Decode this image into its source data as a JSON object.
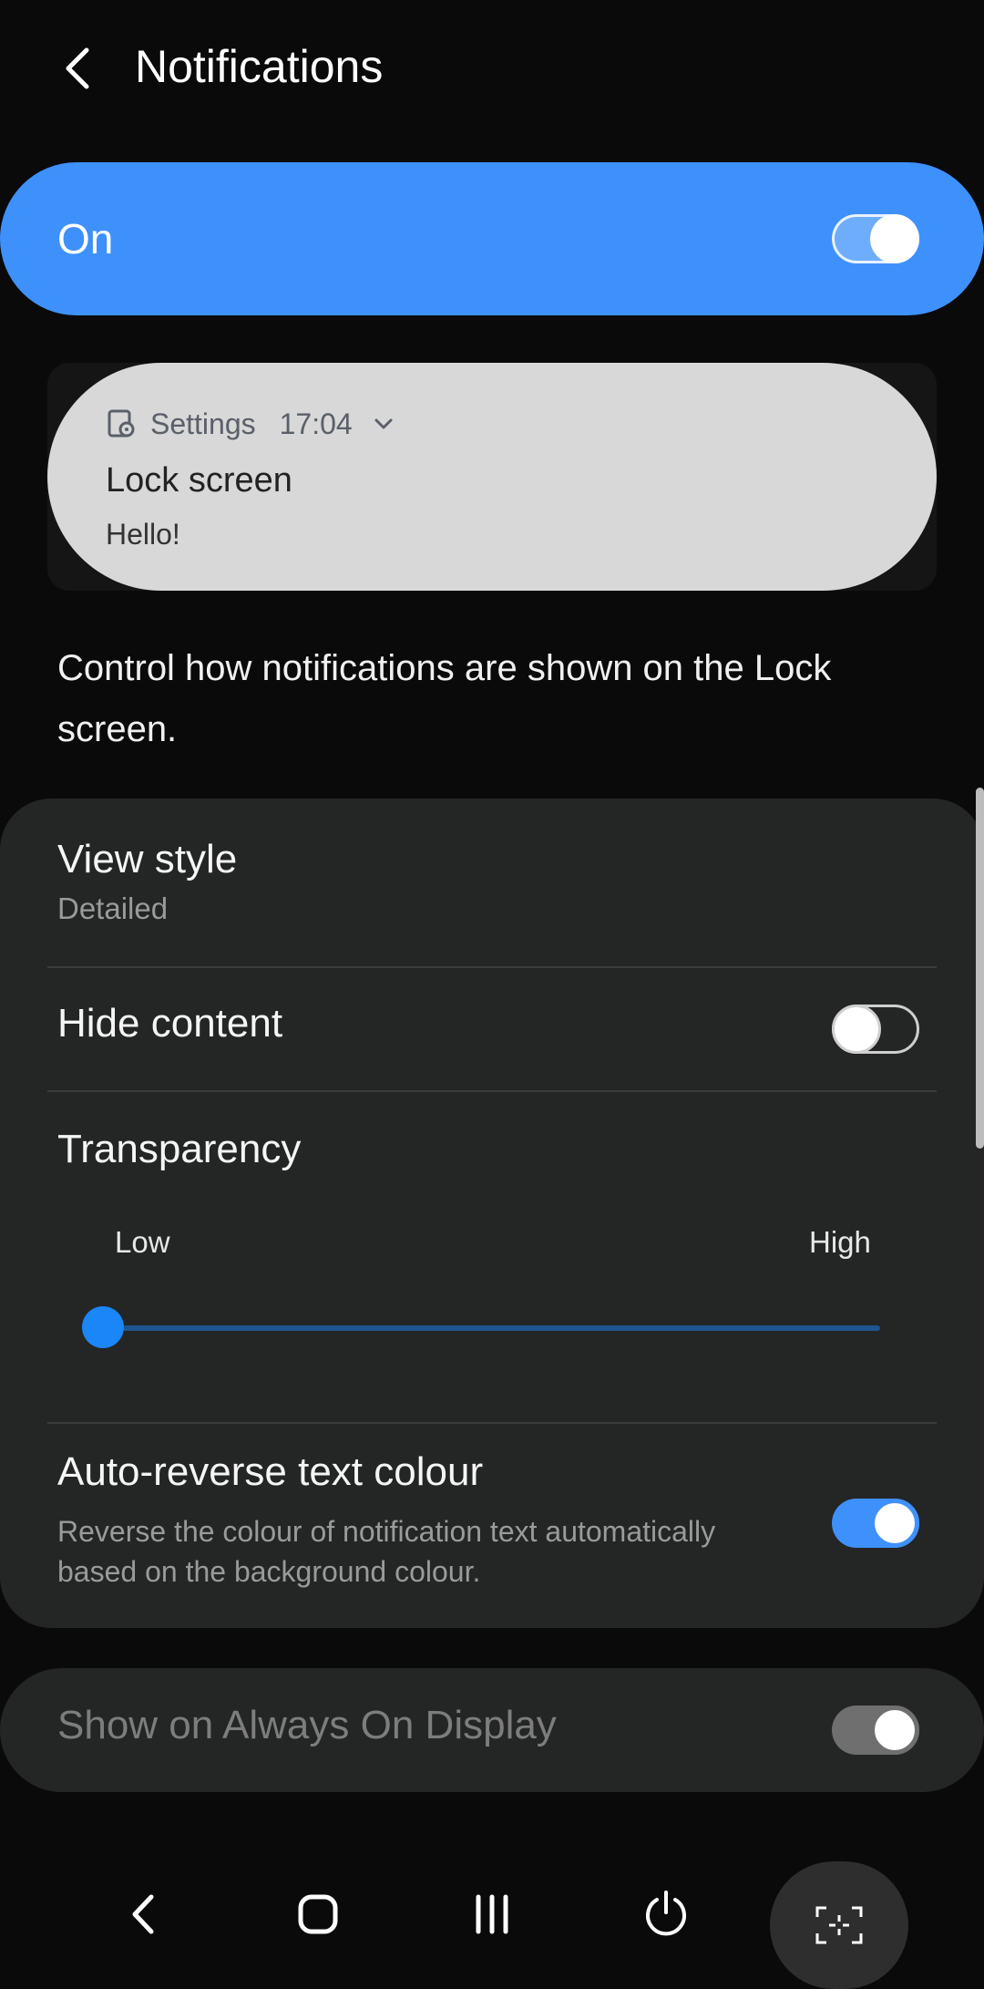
{
  "header": {
    "title": "Notifications"
  },
  "master": {
    "label": "On",
    "enabled": true,
    "accent_color": "#3e91fb"
  },
  "preview": {
    "app_icon": "settings-app-icon",
    "app_name": "Settings",
    "time": "17:04",
    "expand_icon": "chevron-down-icon",
    "title": "Lock screen",
    "body": "Hello!"
  },
  "description": "Control how notifications are shown on the Lock screen.",
  "settings": {
    "view_style": {
      "title": "View style",
      "value": "Detailed"
    },
    "hide_content": {
      "title": "Hide content",
      "enabled": false
    },
    "transparency": {
      "title": "Transparency",
      "min_label": "Low",
      "max_label": "High",
      "level": 0
    },
    "auto_reverse": {
      "title": "Auto-reverse text colour",
      "description": "Reverse the colour of notification text automatically based on the background colour.",
      "enabled": true
    },
    "always_on_display": {
      "title": "Show on Always On Display",
      "enabled": true,
      "disabled_state": true
    }
  },
  "navbar": {
    "items": [
      "back-icon",
      "home-icon",
      "recents-icon",
      "power-icon",
      "capture-icon"
    ]
  }
}
